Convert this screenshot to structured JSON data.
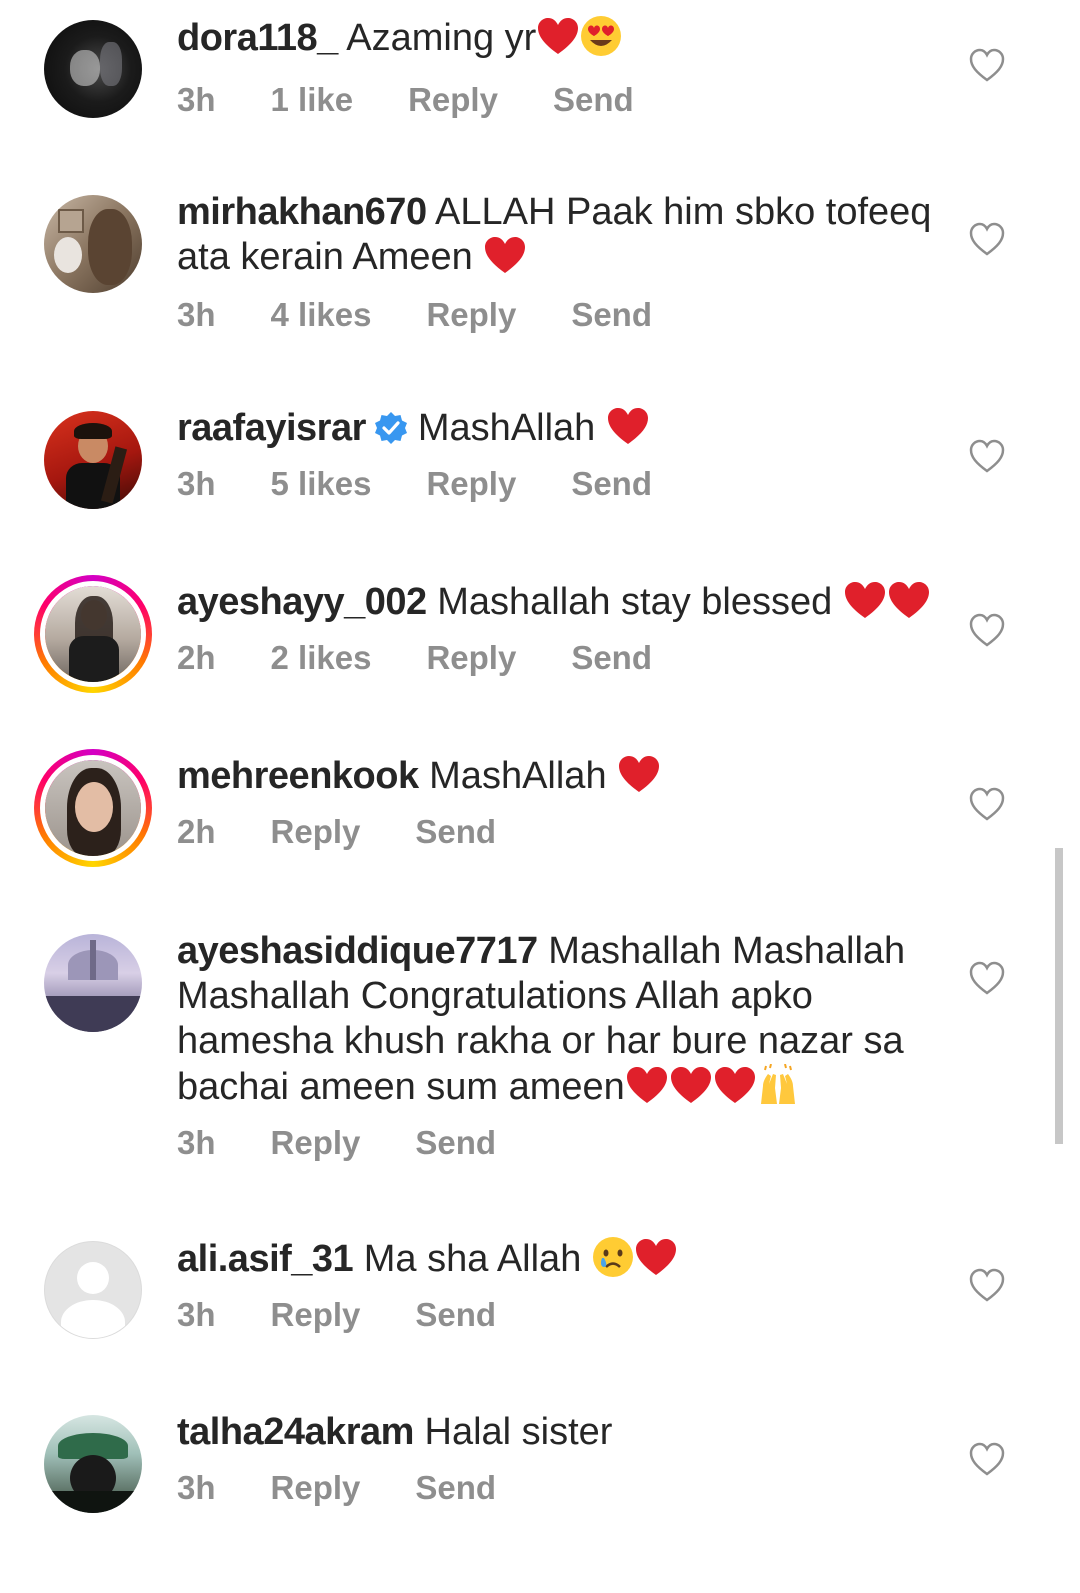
{
  "comments": [
    {
      "username": "dora118_",
      "text": "Azaming yr",
      "emojis": [
        "heart",
        "heart-eyes"
      ],
      "time": "3h",
      "likes": "1 like",
      "reply": "Reply",
      "send": "Send"
    },
    {
      "username": "mirhakhan670",
      "text": "ALLAH Paak him sbko tofeeq ata kerain Ameen ",
      "emojis": [
        "heart"
      ],
      "time": "3h",
      "likes": "4 likes",
      "reply": "Reply",
      "send": "Send"
    },
    {
      "username": "raafayisrar",
      "verified": true,
      "text": "MashAllah ",
      "emojis": [
        "heart"
      ],
      "time": "3h",
      "likes": "5 likes",
      "reply": "Reply",
      "send": "Send"
    },
    {
      "username": "ayeshayy_002",
      "text": "Mashallah stay blessed ",
      "emojis": [
        "heart",
        "heart"
      ],
      "time": "2h",
      "likes": "2 likes",
      "reply": "Reply",
      "send": "Send"
    },
    {
      "username": "mehreenkook",
      "text": "MashAllah ",
      "emojis": [
        "heart"
      ],
      "time": "2h",
      "reply": "Reply",
      "send": "Send"
    },
    {
      "username": "ayeshasiddique7717",
      "text": "Mashallah Mashallah Mashallah Congratulations Allah apko hamesha khush rakha or har bure nazar sa bachai ameen sum ameen",
      "emojis": [
        "heart",
        "heart",
        "heart",
        "raising-hands"
      ],
      "time": "3h",
      "reply": "Reply",
      "send": "Send"
    },
    {
      "username": "ali.asif_31",
      "text": "Ma sha Allah ",
      "emojis": [
        "crying-face",
        "heart"
      ],
      "time": "3h",
      "reply": "Reply",
      "send": "Send"
    },
    {
      "username": "talha24akram",
      "text": "Halal sister",
      "emojis": [],
      "time": "3h",
      "reply": "Reply",
      "send": "Send"
    }
  ],
  "colors": {
    "heart": "#e0202b",
    "meta_text": "#8e8e8e",
    "verified": "#3897f0"
  }
}
